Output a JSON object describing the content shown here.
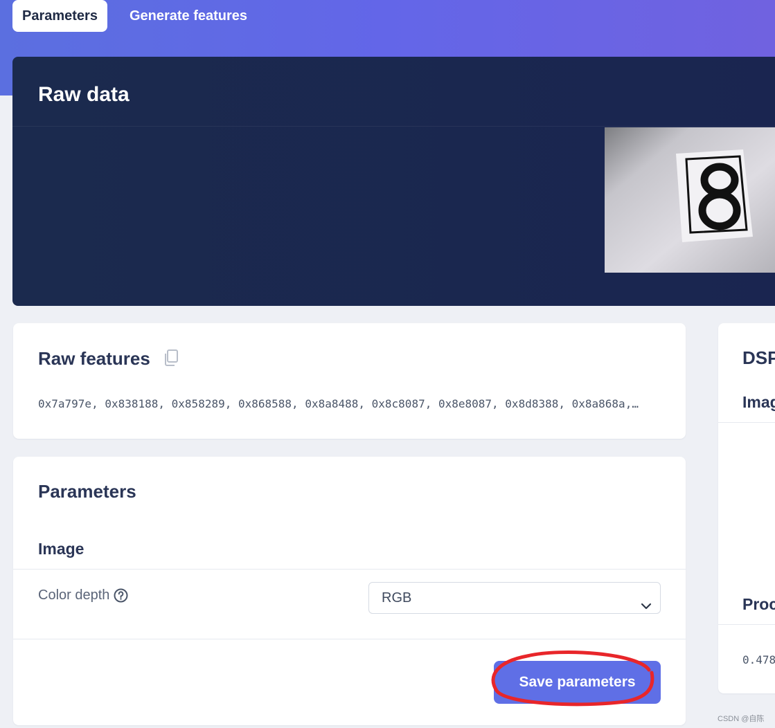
{
  "tabs": [
    {
      "label": "Parameters",
      "active": true
    },
    {
      "label": "Generate features",
      "active": false
    }
  ],
  "raw_data": {
    "title": "Raw data",
    "sample_image": {
      "digit": "8"
    }
  },
  "raw_features": {
    "title": "Raw features",
    "copy_icon": "copy-icon",
    "values": "0x7a797e, 0x838188, 0x858289, 0x868588, 0x8a8488, 0x8c8087, 0x8e8087, 0x8d8388, 0x8a868a,…"
  },
  "parameters": {
    "title": "Parameters",
    "section": "Image",
    "color_depth": {
      "label": "Color depth",
      "help_icon": "help-circle-icon",
      "selected": "RGB"
    },
    "save_label": "Save parameters"
  },
  "dsp_panel": {
    "title": "DSP",
    "subtitle": "Imag",
    "processed": "Proc",
    "value": "0.478"
  },
  "watermark": "CSDN @自陈",
  "colors": {
    "header_gradient_start": "#5b6fe0",
    "header_gradient_end": "#7062e0",
    "raw_data_bg": "#1b2a4e",
    "accent_button": "#5f6fe6",
    "annotation": "#e8262a"
  }
}
